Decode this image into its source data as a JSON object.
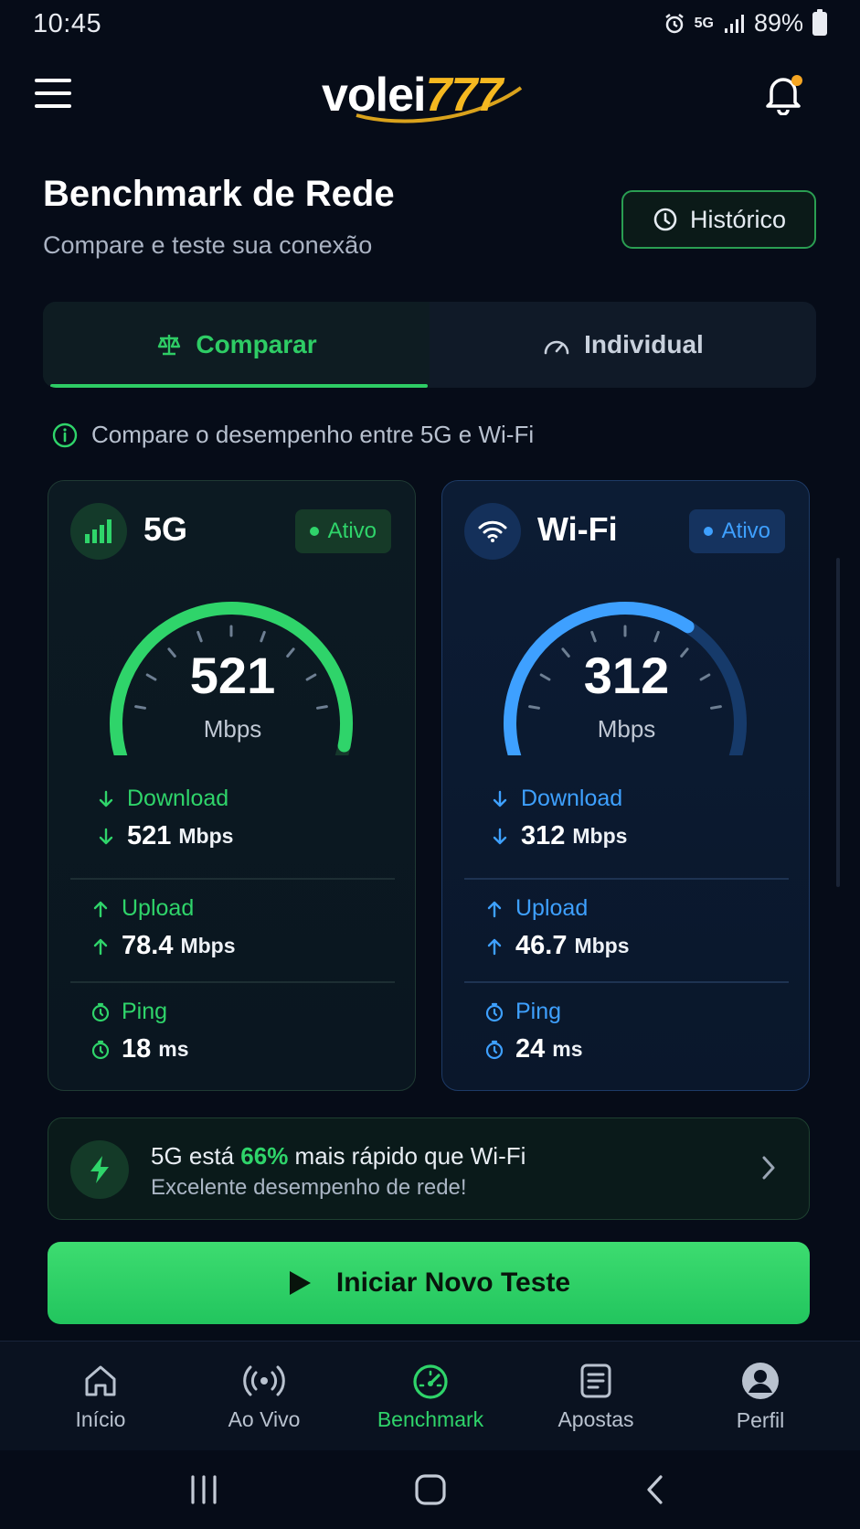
{
  "status": {
    "time": "10:45",
    "network": "5G",
    "battery": "89%"
  },
  "header": {
    "logo_main": "volei",
    "logo_accent": "777"
  },
  "page": {
    "title": "Benchmark de Rede",
    "subtitle": "Compare e teste sua conexão",
    "history_label": "Histórico"
  },
  "tabs": [
    {
      "label": "Comparar",
      "active": true
    },
    {
      "label": "Individual",
      "active": false
    }
  ],
  "info_text": "Compare o desempenho entre 5G e Wi-Fi",
  "cards": {
    "g5": {
      "name": "5G",
      "badge": "Ativo",
      "accent": "#2fd46a",
      "speed": "521",
      "speed_unit": "Mbps",
      "gauge_fraction": 0.96,
      "download_label": "Download",
      "download_value": "521",
      "download_unit": "Mbps",
      "upload_label": "Upload",
      "upload_value": "78.4",
      "upload_unit": "Mbps",
      "ping_label": "Ping",
      "ping_value": "18",
      "ping_unit": "ms"
    },
    "wifi": {
      "name": "Wi-Fi",
      "badge": "Ativo",
      "accent": "#3ea0ff",
      "speed": "312",
      "speed_unit": "Mbps",
      "gauge_fraction": 0.65,
      "download_label": "Download",
      "download_value": "312",
      "download_unit": "Mbps",
      "upload_label": "Upload",
      "upload_value": "46.7",
      "upload_unit": "Mbps",
      "ping_label": "Ping",
      "ping_value": "24",
      "ping_unit": "ms"
    }
  },
  "result": {
    "prefix": "5G está ",
    "highlight": "66%",
    "suffix": " mais rápido que Wi-Fi",
    "subtitle": "Excelente desempenho de rede!"
  },
  "start_button": "Iniciar Novo Teste",
  "nav": [
    {
      "label": "Início",
      "icon": "home-icon"
    },
    {
      "label": "Ao Vivo",
      "icon": "broadcast-icon"
    },
    {
      "label": "Benchmark",
      "icon": "speedometer-icon",
      "active": true
    },
    {
      "label": "Apostas",
      "icon": "ticket-icon"
    },
    {
      "label": "Perfil",
      "icon": "user-icon"
    }
  ]
}
